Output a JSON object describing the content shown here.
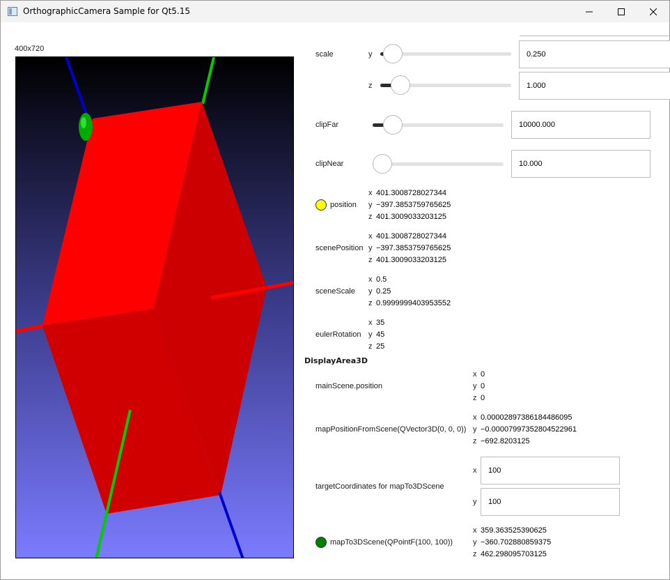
{
  "window": {
    "title": "OrthographicCamera Sample for Qt5.15"
  },
  "viewport_label": "400x720",
  "scale": {
    "label": "scale",
    "y": {
      "axis": "y",
      "value": "0.250",
      "fraction": 0.0
    },
    "z": {
      "axis": "z",
      "value": "1.000",
      "fraction": 0.1
    }
  },
  "clipFar": {
    "label": "clipFar",
    "value": "10000.000",
    "fraction": 0.1
  },
  "clipNear": {
    "label": "clipNear",
    "value": "10.000",
    "fraction": 0.0
  },
  "position": {
    "label": "position",
    "x": "401.3008728027344",
    "y": "−397.3853759765625",
    "z": "401.3009033203125",
    "color": "#ffff00"
  },
  "scenePosition": {
    "label": "scenePosition",
    "x": "401.3008728027344",
    "y": "−397.3853759765625",
    "z": "401.3009033203125"
  },
  "sceneScale": {
    "label": "sceneScale",
    "x": "0.5",
    "y": "0.25",
    "z": "0.9999999403953552"
  },
  "eulerRotation": {
    "label": "eulerRotation",
    "x": "35",
    "y": "45",
    "z": "25"
  },
  "section": "DisplayArea3D",
  "mainScenePosition": {
    "label": "mainScene.position",
    "x": "0",
    "y": "0",
    "z": "0"
  },
  "mapPositionFromScene": {
    "label": "mapPositionFromScene(QVector3D(0, 0, 0))",
    "x": "0.00002897386184486095",
    "y": "−0.00007997352804522961",
    "z": "−692.8203125"
  },
  "targetCoordinates": {
    "label": "targetCoordinates for mapTo3DScene",
    "x": "100",
    "y": "100"
  },
  "mapTo3DScene": {
    "label": "mapTo3DScene(QPointF(100, 100))",
    "x": "359.363525390625",
    "y": "−360.702880859375",
    "z": "462.298095703125",
    "color": "#008000"
  },
  "axis_names": {
    "x": "x",
    "y": "y",
    "z": "z"
  },
  "scene_colors": {
    "cube_top": "#ff0000",
    "cube_side": "#cc0000",
    "bg_top": "#000000",
    "bg_bottom": "#7b7bff",
    "axis_x": "#ff0000",
    "axis_y": "#00cc00",
    "axis_z": "#0000cc",
    "marker": "#00aa00"
  }
}
